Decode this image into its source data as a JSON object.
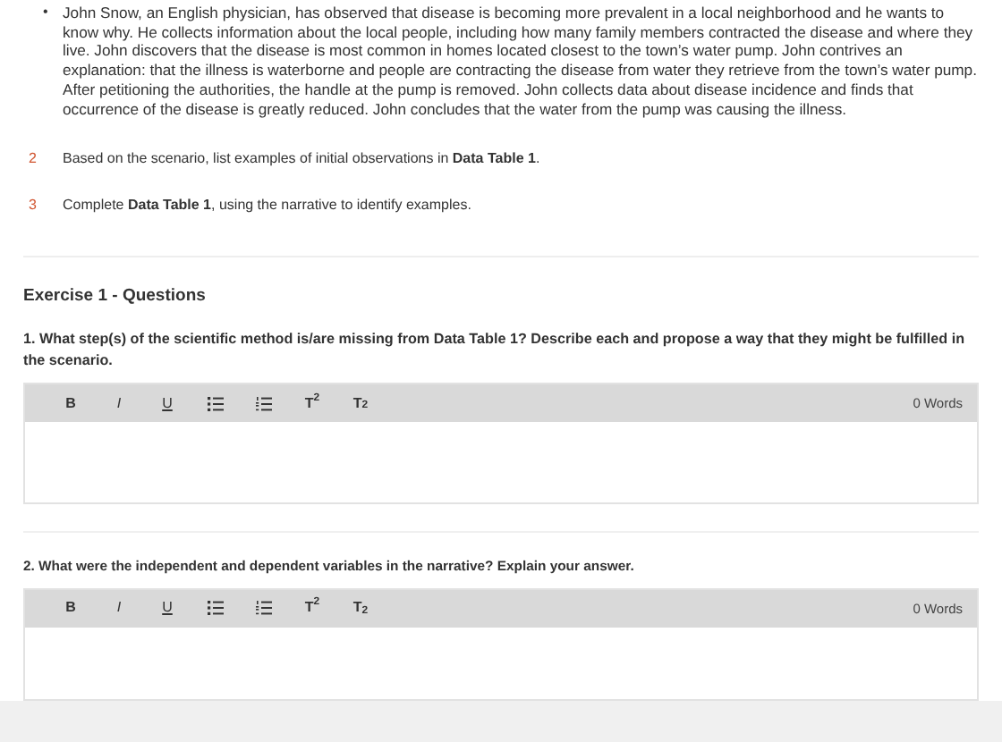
{
  "scenario": {
    "bullet": "•",
    "text": "John Snow, an English physician, has observed that disease is becoming more prevalent in a local neighborhood and he wants to know why. He collects information about the local people, including how many family members contracted the disease and where they live. John discovers that the disease is most common in homes located closest to the town’s water pump. John contrives an explanation: that the illness is waterborne and people are contracting the disease from water they retrieve from the town’s water pump. After petitioning the authorities, the handle at the pump is removed. John collects data about disease incidence and finds that occurrence of the disease is greatly reduced. John concludes that the water from the pump was causing the illness."
  },
  "steps": [
    {
      "number": "2",
      "text": "Based on the scenario, list examples of initial observations in **Data Table 1**."
    },
    {
      "number": "3",
      "text": "Complete **Data Table 1**, using the narrative to identify examples."
    }
  ],
  "section_title": "Exercise 1 - Questions",
  "questions": [
    {
      "text": "1. What step(s) of the scientific method is/are missing from Data Table 1? Describe each and propose a way that they might be fulfilled in the scenario.",
      "word_count": "0 Words",
      "toolbar": [
        {
          "kind": "bold",
          "label": "B"
        },
        {
          "kind": "italic",
          "label": "I"
        },
        {
          "kind": "underline",
          "label": "U"
        },
        {
          "kind": "bullets"
        },
        {
          "kind": "numbers"
        },
        {
          "kind": "script",
          "label": "T$^{2}$"
        },
        {
          "kind": "script",
          "label": "T$_{2}$"
        }
      ]
    },
    {
      "text": "2. What were the independent and dependent variables in the narrative? Explain your answer.",
      "word_count": "0 Words",
      "toolbar": [
        {
          "kind": "bold",
          "label": "B"
        },
        {
          "kind": "italic",
          "label": "I"
        },
        {
          "kind": "underline",
          "label": "U"
        },
        {
          "kind": "bullets"
        },
        {
          "kind": "numbers"
        },
        {
          "kind": "script",
          "label": "T$^{2}$"
        },
        {
          "kind": "script",
          "label": "T$_{2}$"
        }
      ]
    }
  ]
}
